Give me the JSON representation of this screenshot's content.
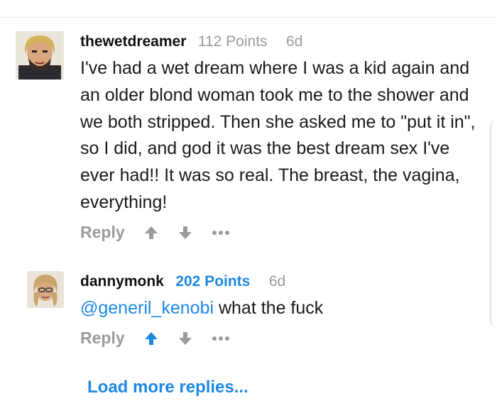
{
  "comments": [
    {
      "username": "thewetdreamer",
      "points": "112 Points",
      "age": "6d",
      "text": "I've had a wet dream where I was a kid again and an older blond woman took me to the shower and we both stripped. Then she asked me to \"put it in\", so I did, and god it was the best dream sex I've ever had!! It was so real. The breast, the vagina, everything!",
      "reply_label": "Reply",
      "upvoted": false
    },
    {
      "username": "dannymonk",
      "points": "202 Points",
      "age": "6d",
      "mention": "@generil_kenobi",
      "text": " what the fuck",
      "reply_label": "Reply",
      "upvoted": true
    }
  ],
  "load_more_label": "Load more replies...",
  "colors": {
    "accent": "#1e88e5",
    "muted": "#9b9b9b",
    "text": "#1a1a1a"
  },
  "icons": [
    "avatar",
    "arrow-up-icon",
    "arrow-down-icon",
    "more-dots-icon"
  ]
}
